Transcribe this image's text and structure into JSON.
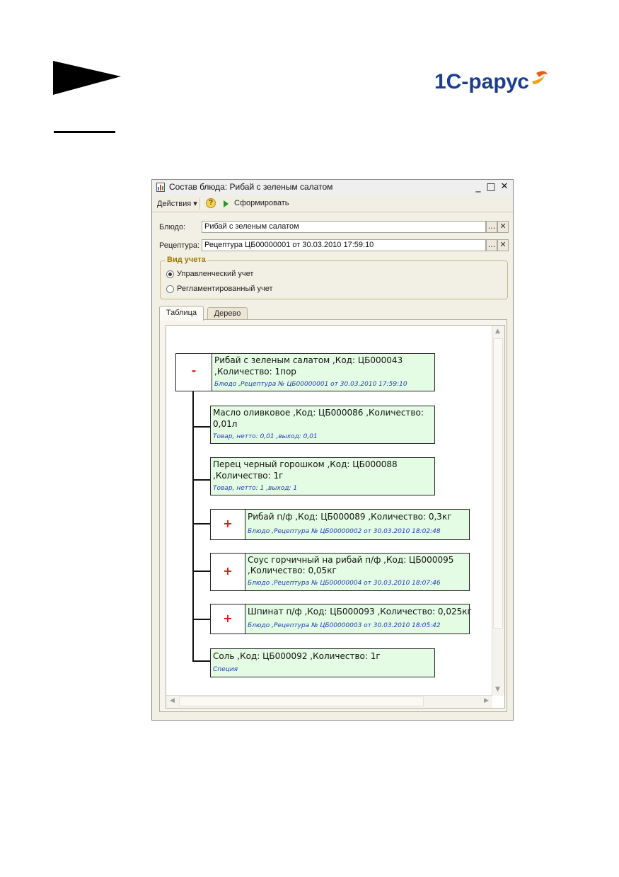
{
  "window": {
    "title": "Состав блюда: Рибай с зеленым салатом",
    "minimize_glyph": "_",
    "maximize_glyph": "□",
    "close_glyph": "✕"
  },
  "toolbar": {
    "actions_label": "Действия",
    "actions_caret": "▾",
    "help_glyph": "?",
    "generate_label": "Сформировать"
  },
  "form": {
    "dish_label": "Блюдо:",
    "dish_value": "Рибай с зеленым салатом",
    "recipe_label": "Рецептура:",
    "recipe_value": "Рецептура ЦБ00000001 от 30.03.2010 17:59:10",
    "select_glyph": "...",
    "clear_glyph": "✕"
  },
  "accounting": {
    "legend": "Вид учета",
    "options": [
      {
        "label": "Управленческий учет",
        "selected": true
      },
      {
        "label": "Регламентированный учет",
        "selected": false
      }
    ]
  },
  "tabs": [
    {
      "label": "Таблица",
      "active": true
    },
    {
      "label": "Дерево",
      "active": false
    }
  ],
  "tree": {
    "root": {
      "toggle": "-",
      "line1": "Рибай с зеленым салатом  ,Код: ЦБ000043",
      "line2": ",Количество: 1пор",
      "note": "Блюдо ,Рецептура № ЦБ00000001 от 30.03.2010 17:59:10"
    },
    "children": [
      {
        "toggle": "",
        "line1": "Масло оливковое ,Код: ЦБ000086 ,Количество:",
        "line2": "0,01л",
        "note": "Товар, нетто: 0,01 ,выход: 0,01"
      },
      {
        "toggle": "",
        "line1": "Перец черный горошком ,Код: ЦБ000088",
        "line2": ",Количество: 1г",
        "note": "Товар, нетто: 1 ,выход: 1"
      },
      {
        "toggle": "+",
        "line1": "Рибай п/ф ,Код: ЦБ000089 ,Количество: 0,3кг",
        "line2": "",
        "note": "Блюдо ,Рецептура № ЦБ00000002 от 30.03.2010 18:02:48"
      },
      {
        "toggle": "+",
        "line1": "Соус горчичный на рибай п/ф ,Код: ЦБ000095",
        "line2": ",Количество: 0,05кг",
        "note": "Блюдо ,Рецептура № ЦБ00000004 от 30.03.2010 18:07:46"
      },
      {
        "toggle": "+",
        "line1": "Шпинат п/ф ,Код: ЦБ000093 ,Количество: 0,025кг",
        "line2": "",
        "note": "Блюдо ,Рецептура № ЦБ00000003 от 30.03.2010 18:05:42"
      },
      {
        "toggle": "",
        "line1": "Соль ,Код: ЦБ000092 ,Количество: 1г",
        "line2": "",
        "note": "Специя"
      }
    ]
  },
  "scrollbars": {
    "up": "▲",
    "down": "▼",
    "left": "◀",
    "right": "▶"
  },
  "logo_text": "1С-рарус"
}
